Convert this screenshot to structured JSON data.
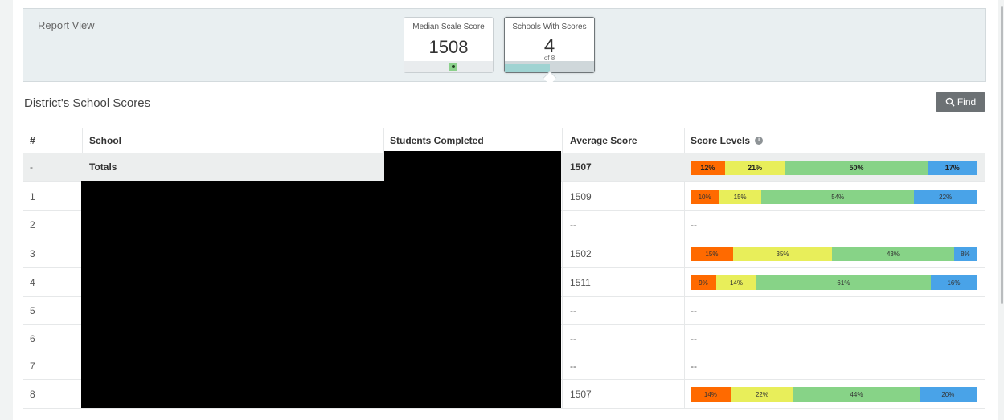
{
  "report_view": {
    "label": "Report View",
    "median_card": {
      "title": "Median Scale Score",
      "value": "1508"
    },
    "schools_card": {
      "title": "Schools With Scores",
      "value": "4",
      "sub": "of 8",
      "fraction": 0.5
    }
  },
  "section": {
    "title": "District's School Scores",
    "find_label": "Find"
  },
  "table": {
    "headers": {
      "num": "#",
      "school": "School",
      "students": "Students Completed",
      "avg": "Average Score",
      "levels": "Score Levels"
    },
    "rows": [
      {
        "num": "-",
        "school": "Totals",
        "avg": "1507",
        "levels": [
          12,
          21,
          50,
          17
        ],
        "levels_text": ""
      },
      {
        "num": "1",
        "school": "",
        "avg": "1509",
        "levels": [
          10,
          15,
          54,
          22
        ],
        "levels_text": ""
      },
      {
        "num": "2",
        "school": "",
        "avg": "--",
        "levels": null,
        "levels_text": "--"
      },
      {
        "num": "3",
        "school": "",
        "avg": "1502",
        "levels": [
          15,
          35,
          43,
          8
        ],
        "levels_text": ""
      },
      {
        "num": "4",
        "school": "",
        "avg": "1511",
        "levels": [
          9,
          14,
          61,
          16
        ],
        "levels_text": ""
      },
      {
        "num": "5",
        "school": "",
        "avg": "--",
        "levels": null,
        "levels_text": "--"
      },
      {
        "num": "6",
        "school": "",
        "avg": "--",
        "levels": null,
        "levels_text": "--"
      },
      {
        "num": "7",
        "school": "",
        "avg": "--",
        "levels": null,
        "levels_text": "--"
      },
      {
        "num": "8",
        "school": "",
        "avg": "1507",
        "levels": [
          14,
          22,
          44,
          20
        ],
        "levels_text": ""
      }
    ]
  },
  "level_colors": [
    "#ff6a00",
    "#e8ee5a",
    "#87d387",
    "#49a3e8"
  ]
}
